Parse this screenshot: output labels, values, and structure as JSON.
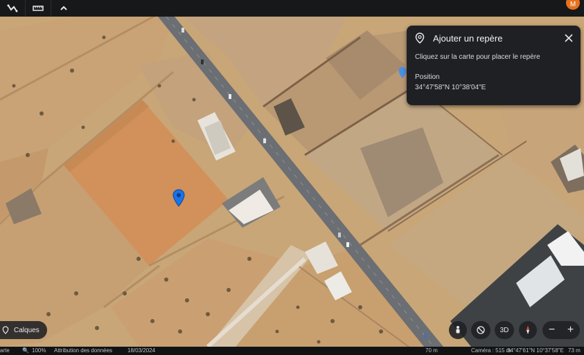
{
  "toolbar": {
    "buttons": [
      {
        "name": "path-tool",
        "icon": "path-icon"
      },
      {
        "name": "measure-tool",
        "icon": "ruler-icon"
      },
      {
        "name": "collapse-toolbar",
        "icon": "chevron-up-icon"
      }
    ],
    "avatar_initial": "M",
    "avatar_color": "#e8711c"
  },
  "panel": {
    "title": "Ajouter un repère",
    "hint": "Cliquez sur la carte pour placer le repère",
    "position_label": "Position",
    "position_value": "34°47'58\"N 10°38'04\"E",
    "icon": "map-pin-icon",
    "close_icon": "close-icon"
  },
  "controls": {
    "layers_label": "Calques",
    "view_3d_label": "3D",
    "zoom_in": "+",
    "zoom_out": "−",
    "icons": [
      "street-view-icon",
      "no-tilt-icon",
      "compass-icon"
    ]
  },
  "status": {
    "left_text": "arte",
    "zoom_level": "100%",
    "attribution": "Attribution des données",
    "date": "18/03/2024",
    "scale": "70 m",
    "camera": "Caméra : 515 m",
    "coords": "34°47'61\"N 10°37'58\"E",
    "altitude": "73 m"
  },
  "colors": {
    "marker_blue": "#1a73e8",
    "panel_bg": "#1f2023",
    "road": "#6b6e73"
  }
}
